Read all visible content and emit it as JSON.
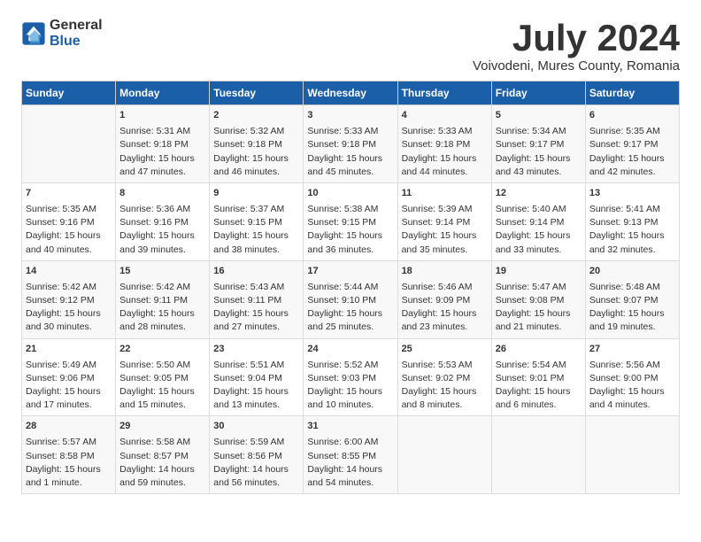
{
  "logo": {
    "general": "General",
    "blue": "Blue"
  },
  "title": "July 2024",
  "subtitle": "Voivodeni, Mures County, Romania",
  "weekdays": [
    "Sunday",
    "Monday",
    "Tuesday",
    "Wednesday",
    "Thursday",
    "Friday",
    "Saturday"
  ],
  "weeks": [
    [
      {
        "day": "",
        "content": ""
      },
      {
        "day": "1",
        "content": "Sunrise: 5:31 AM\nSunset: 9:18 PM\nDaylight: 15 hours\nand 47 minutes."
      },
      {
        "day": "2",
        "content": "Sunrise: 5:32 AM\nSunset: 9:18 PM\nDaylight: 15 hours\nand 46 minutes."
      },
      {
        "day": "3",
        "content": "Sunrise: 5:33 AM\nSunset: 9:18 PM\nDaylight: 15 hours\nand 45 minutes."
      },
      {
        "day": "4",
        "content": "Sunrise: 5:33 AM\nSunset: 9:18 PM\nDaylight: 15 hours\nand 44 minutes."
      },
      {
        "day": "5",
        "content": "Sunrise: 5:34 AM\nSunset: 9:17 PM\nDaylight: 15 hours\nand 43 minutes."
      },
      {
        "day": "6",
        "content": "Sunrise: 5:35 AM\nSunset: 9:17 PM\nDaylight: 15 hours\nand 42 minutes."
      }
    ],
    [
      {
        "day": "7",
        "content": "Sunrise: 5:35 AM\nSunset: 9:16 PM\nDaylight: 15 hours\nand 40 minutes."
      },
      {
        "day": "8",
        "content": "Sunrise: 5:36 AM\nSunset: 9:16 PM\nDaylight: 15 hours\nand 39 minutes."
      },
      {
        "day": "9",
        "content": "Sunrise: 5:37 AM\nSunset: 9:15 PM\nDaylight: 15 hours\nand 38 minutes."
      },
      {
        "day": "10",
        "content": "Sunrise: 5:38 AM\nSunset: 9:15 PM\nDaylight: 15 hours\nand 36 minutes."
      },
      {
        "day": "11",
        "content": "Sunrise: 5:39 AM\nSunset: 9:14 PM\nDaylight: 15 hours\nand 35 minutes."
      },
      {
        "day": "12",
        "content": "Sunrise: 5:40 AM\nSunset: 9:14 PM\nDaylight: 15 hours\nand 33 minutes."
      },
      {
        "day": "13",
        "content": "Sunrise: 5:41 AM\nSunset: 9:13 PM\nDaylight: 15 hours\nand 32 minutes."
      }
    ],
    [
      {
        "day": "14",
        "content": "Sunrise: 5:42 AM\nSunset: 9:12 PM\nDaylight: 15 hours\nand 30 minutes."
      },
      {
        "day": "15",
        "content": "Sunrise: 5:42 AM\nSunset: 9:11 PM\nDaylight: 15 hours\nand 28 minutes."
      },
      {
        "day": "16",
        "content": "Sunrise: 5:43 AM\nSunset: 9:11 PM\nDaylight: 15 hours\nand 27 minutes."
      },
      {
        "day": "17",
        "content": "Sunrise: 5:44 AM\nSunset: 9:10 PM\nDaylight: 15 hours\nand 25 minutes."
      },
      {
        "day": "18",
        "content": "Sunrise: 5:46 AM\nSunset: 9:09 PM\nDaylight: 15 hours\nand 23 minutes."
      },
      {
        "day": "19",
        "content": "Sunrise: 5:47 AM\nSunset: 9:08 PM\nDaylight: 15 hours\nand 21 minutes."
      },
      {
        "day": "20",
        "content": "Sunrise: 5:48 AM\nSunset: 9:07 PM\nDaylight: 15 hours\nand 19 minutes."
      }
    ],
    [
      {
        "day": "21",
        "content": "Sunrise: 5:49 AM\nSunset: 9:06 PM\nDaylight: 15 hours\nand 17 minutes."
      },
      {
        "day": "22",
        "content": "Sunrise: 5:50 AM\nSunset: 9:05 PM\nDaylight: 15 hours\nand 15 minutes."
      },
      {
        "day": "23",
        "content": "Sunrise: 5:51 AM\nSunset: 9:04 PM\nDaylight: 15 hours\nand 13 minutes."
      },
      {
        "day": "24",
        "content": "Sunrise: 5:52 AM\nSunset: 9:03 PM\nDaylight: 15 hours\nand 10 minutes."
      },
      {
        "day": "25",
        "content": "Sunrise: 5:53 AM\nSunset: 9:02 PM\nDaylight: 15 hours\nand 8 minutes."
      },
      {
        "day": "26",
        "content": "Sunrise: 5:54 AM\nSunset: 9:01 PM\nDaylight: 15 hours\nand 6 minutes."
      },
      {
        "day": "27",
        "content": "Sunrise: 5:56 AM\nSunset: 9:00 PM\nDaylight: 15 hours\nand 4 minutes."
      }
    ],
    [
      {
        "day": "28",
        "content": "Sunrise: 5:57 AM\nSunset: 8:58 PM\nDaylight: 15 hours\nand 1 minute."
      },
      {
        "day": "29",
        "content": "Sunrise: 5:58 AM\nSunset: 8:57 PM\nDaylight: 14 hours\nand 59 minutes."
      },
      {
        "day": "30",
        "content": "Sunrise: 5:59 AM\nSunset: 8:56 PM\nDaylight: 14 hours\nand 56 minutes."
      },
      {
        "day": "31",
        "content": "Sunrise: 6:00 AM\nSunset: 8:55 PM\nDaylight: 14 hours\nand 54 minutes."
      },
      {
        "day": "",
        "content": ""
      },
      {
        "day": "",
        "content": ""
      },
      {
        "day": "",
        "content": ""
      }
    ]
  ]
}
